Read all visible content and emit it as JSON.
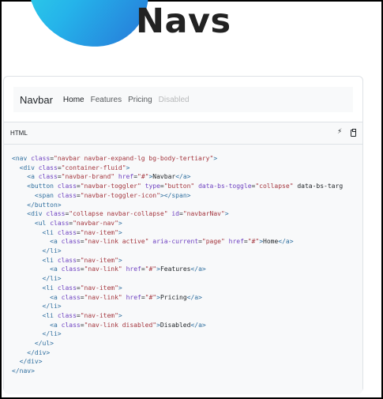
{
  "header": {
    "title": "Navs"
  },
  "example": {
    "brand": "Navbar",
    "links": [
      {
        "label": "Home",
        "state": "active"
      },
      {
        "label": "Features",
        "state": "normal"
      },
      {
        "label": "Pricing",
        "state": "normal"
      },
      {
        "label": "Disabled",
        "state": "disabled"
      }
    ]
  },
  "code_block": {
    "language": "HTML",
    "actions": [
      {
        "icon": "lightning-icon"
      },
      {
        "icon": "clipboard-icon"
      }
    ],
    "lines": [
      "<nav class=\"navbar navbar-expand-lg bg-body-tertiary\">",
      "  <div class=\"container-fluid\">",
      "    <a class=\"navbar-brand\" href=\"#\">Navbar</a>",
      "    <button class=\"navbar-toggler\" type=\"button\" data-bs-toggle=\"collapse\" data-bs-targ",
      "      <span class=\"navbar-toggler-icon\"></span>",
      "    </button>",
      "    <div class=\"collapse navbar-collapse\" id=\"navbarNav\">",
      "      <ul class=\"navbar-nav\">",
      "        <li class=\"nav-item\">",
      "          <a class=\"nav-link active\" aria-current=\"page\" href=\"#\">Home</a>",
      "        </li>",
      "        <li class=\"nav-item\">",
      "          <a class=\"nav-link\" href=\"#\">Features</a>",
      "        </li>",
      "        <li class=\"nav-item\">",
      "          <a class=\"nav-link\" href=\"#\">Pricing</a>",
      "        </li>",
      "        <li class=\"nav-item\">",
      "          <a class=\"nav-link disabled\">Disabled</a>",
      "        </li>",
      "      </ul>",
      "    </div>",
      "  </div>",
      "</nav>"
    ]
  },
  "colors": {
    "tag": "#2f6f9f",
    "attr": "#6f42c1",
    "string": "#a4363e",
    "blob_start": "#2fd7e7",
    "blob_end": "#2676d8"
  }
}
